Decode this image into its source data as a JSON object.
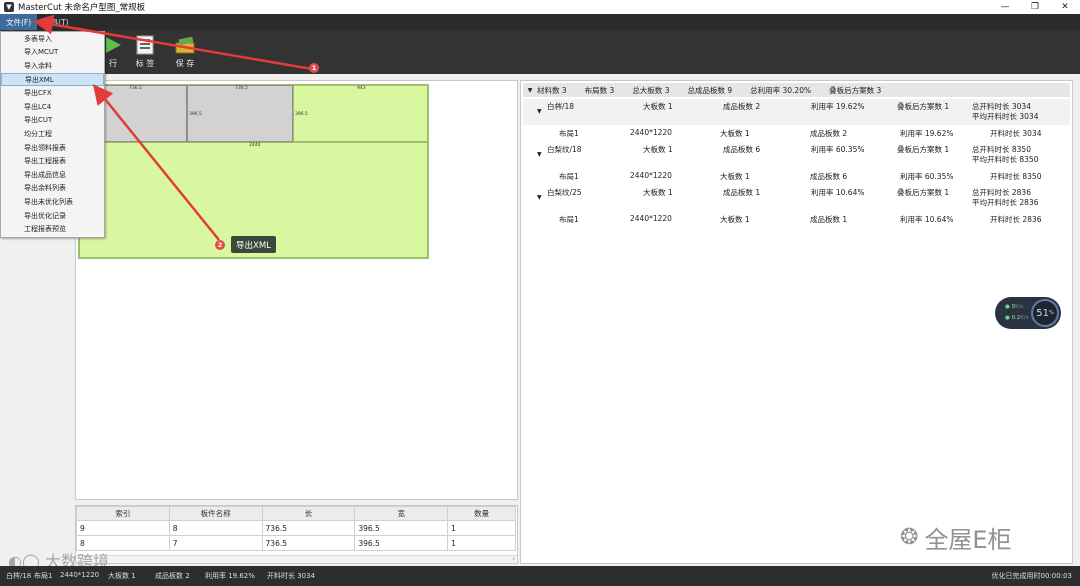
{
  "window": {
    "title": "MasterCut 未命名户型图_常规板",
    "app_icon": "app-logo-icon",
    "controls": [
      "—",
      "❐",
      "✕"
    ]
  },
  "menubar": {
    "items": [
      {
        "label": "文件(F)",
        "active": true
      },
      {
        "label": "工具(T)",
        "active": false
      }
    ]
  },
  "toolbar": {
    "run_label": "行",
    "label_label": "标 签",
    "save_label": "保 存"
  },
  "file_menu": {
    "items": [
      "多表导入",
      "导入MCUT",
      "导入余料",
      "导出XML",
      "导出CFX",
      "导出LC4",
      "导出CUT",
      "均分工程",
      "导出领料报表",
      "导出工程报表",
      "导出成品信息",
      "导出余料列表",
      "导出未优化列表",
      "导出优化记录",
      "工程报表预览"
    ],
    "selected": "导出XML"
  },
  "annotations": {
    "badge1": "1",
    "badge2": "2",
    "tooltip": "导出XML",
    "arrow_color": "#e23b3b"
  },
  "layout_preview": {
    "labels": {
      "w1": "736.5",
      "w2": "736.5",
      "w3": "943",
      "h1": "396.5",
      "h2": "396.5",
      "big": "2440"
    },
    "colors": {
      "piece": "#d2d2d2",
      "board": "#d8f7a0"
    }
  },
  "parts_table": {
    "headers": [
      "索引",
      "板件名称",
      "长",
      "宽",
      "数量"
    ],
    "rows": [
      [
        "9",
        "8",
        "736.5",
        "396.5",
        "1"
      ],
      [
        "8",
        "7",
        "736.5",
        "396.5",
        "1"
      ]
    ]
  },
  "summary": {
    "header": [
      "材料数 3",
      "布局数 3",
      "总大板数 3",
      "总成品板数 9",
      "总利用率 30.20%",
      "叠板后方案数 3"
    ],
    "groups": [
      {
        "material": "白梣/18",
        "boards": "大板数 1",
        "parts": "成品板数 2",
        "rate": "利用率 19.62%",
        "plans": "叠板后方案数 1",
        "total_time": "总开料时长 3034",
        "avg_time": "平均开料时长 3034",
        "layout": {
          "name": "布局1",
          "size": "2440*1220",
          "boards": "大板数 1",
          "parts": "成品板数 2",
          "rate": "利用率 19.62%",
          "time": "开料时长 3034"
        }
      },
      {
        "material": "白梨纹/18",
        "boards": "大板数 1",
        "parts": "成品板数 6",
        "rate": "利用率 60.35%",
        "plans": "叠板后方案数 1",
        "total_time": "总开料时长 8350",
        "avg_time": "平均开料时长 8350",
        "layout": {
          "name": "布局1",
          "size": "2440*1220",
          "boards": "大板数 1",
          "parts": "成品板数 6",
          "rate": "利用率 60.35%",
          "time": "开料时长 8350"
        }
      },
      {
        "material": "白梨纹/25",
        "boards": "大板数 1",
        "parts": "成品板数 1",
        "rate": "利用率 10.64%",
        "plans": "叠板后方案数 1",
        "total_time": "总开料时长 2836",
        "avg_time": "平均开料时长 2836",
        "layout": {
          "name": "布局1",
          "size": "2440*1220",
          "boards": "大板数 1",
          "parts": "成品板数 1",
          "rate": "利用率 10.64%",
          "time": "开料时长 2836"
        }
      }
    ]
  },
  "network_widget": {
    "up": "0",
    "up_unit": "K/s",
    "down": "0.2",
    "down_unit": "K/s",
    "percent": "51",
    "percent_unit": "%"
  },
  "statusbar": {
    "material": "白梣/18",
    "layout": "布局1",
    "size": "2440*1220",
    "boards": "大板数 1",
    "parts": "成品板数 2",
    "rate": "利用率 19.62%",
    "time": "开料时长 3034",
    "right": "优化已完成用时00:00:03"
  },
  "watermarks": {
    "right": "全屋E柜",
    "left": "大数跨境"
  }
}
